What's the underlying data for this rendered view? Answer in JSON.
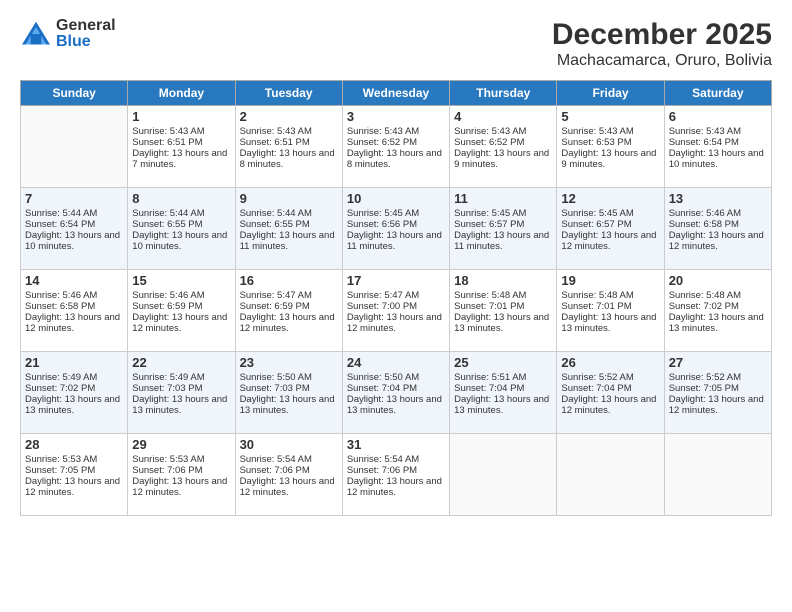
{
  "logo": {
    "general": "General",
    "blue": "Blue"
  },
  "title": "December 2025",
  "subtitle": "Machacamarca, Oruro, Bolivia",
  "days_of_week": [
    "Sunday",
    "Monday",
    "Tuesday",
    "Wednesday",
    "Thursday",
    "Friday",
    "Saturday"
  ],
  "weeks": [
    [
      {
        "day": "",
        "sunrise": "",
        "sunset": "",
        "daylight": ""
      },
      {
        "day": "1",
        "sunrise": "Sunrise: 5:43 AM",
        "sunset": "Sunset: 6:51 PM",
        "daylight": "Daylight: 13 hours and 7 minutes."
      },
      {
        "day": "2",
        "sunrise": "Sunrise: 5:43 AM",
        "sunset": "Sunset: 6:51 PM",
        "daylight": "Daylight: 13 hours and 8 minutes."
      },
      {
        "day": "3",
        "sunrise": "Sunrise: 5:43 AM",
        "sunset": "Sunset: 6:52 PM",
        "daylight": "Daylight: 13 hours and 8 minutes."
      },
      {
        "day": "4",
        "sunrise": "Sunrise: 5:43 AM",
        "sunset": "Sunset: 6:52 PM",
        "daylight": "Daylight: 13 hours and 9 minutes."
      },
      {
        "day": "5",
        "sunrise": "Sunrise: 5:43 AM",
        "sunset": "Sunset: 6:53 PM",
        "daylight": "Daylight: 13 hours and 9 minutes."
      },
      {
        "day": "6",
        "sunrise": "Sunrise: 5:43 AM",
        "sunset": "Sunset: 6:54 PM",
        "daylight": "Daylight: 13 hours and 10 minutes."
      }
    ],
    [
      {
        "day": "7",
        "sunrise": "Sunrise: 5:44 AM",
        "sunset": "Sunset: 6:54 PM",
        "daylight": "Daylight: 13 hours and 10 minutes."
      },
      {
        "day": "8",
        "sunrise": "Sunrise: 5:44 AM",
        "sunset": "Sunset: 6:55 PM",
        "daylight": "Daylight: 13 hours and 10 minutes."
      },
      {
        "day": "9",
        "sunrise": "Sunrise: 5:44 AM",
        "sunset": "Sunset: 6:55 PM",
        "daylight": "Daylight: 13 hours and 11 minutes."
      },
      {
        "day": "10",
        "sunrise": "Sunrise: 5:45 AM",
        "sunset": "Sunset: 6:56 PM",
        "daylight": "Daylight: 13 hours and 11 minutes."
      },
      {
        "day": "11",
        "sunrise": "Sunrise: 5:45 AM",
        "sunset": "Sunset: 6:57 PM",
        "daylight": "Daylight: 13 hours and 11 minutes."
      },
      {
        "day": "12",
        "sunrise": "Sunrise: 5:45 AM",
        "sunset": "Sunset: 6:57 PM",
        "daylight": "Daylight: 13 hours and 12 minutes."
      },
      {
        "day": "13",
        "sunrise": "Sunrise: 5:46 AM",
        "sunset": "Sunset: 6:58 PM",
        "daylight": "Daylight: 13 hours and 12 minutes."
      }
    ],
    [
      {
        "day": "14",
        "sunrise": "Sunrise: 5:46 AM",
        "sunset": "Sunset: 6:58 PM",
        "daylight": "Daylight: 13 hours and 12 minutes."
      },
      {
        "day": "15",
        "sunrise": "Sunrise: 5:46 AM",
        "sunset": "Sunset: 6:59 PM",
        "daylight": "Daylight: 13 hours and 12 minutes."
      },
      {
        "day": "16",
        "sunrise": "Sunrise: 5:47 AM",
        "sunset": "Sunset: 6:59 PM",
        "daylight": "Daylight: 13 hours and 12 minutes."
      },
      {
        "day": "17",
        "sunrise": "Sunrise: 5:47 AM",
        "sunset": "Sunset: 7:00 PM",
        "daylight": "Daylight: 13 hours and 12 minutes."
      },
      {
        "day": "18",
        "sunrise": "Sunrise: 5:48 AM",
        "sunset": "Sunset: 7:01 PM",
        "daylight": "Daylight: 13 hours and 13 minutes."
      },
      {
        "day": "19",
        "sunrise": "Sunrise: 5:48 AM",
        "sunset": "Sunset: 7:01 PM",
        "daylight": "Daylight: 13 hours and 13 minutes."
      },
      {
        "day": "20",
        "sunrise": "Sunrise: 5:48 AM",
        "sunset": "Sunset: 7:02 PM",
        "daylight": "Daylight: 13 hours and 13 minutes."
      }
    ],
    [
      {
        "day": "21",
        "sunrise": "Sunrise: 5:49 AM",
        "sunset": "Sunset: 7:02 PM",
        "daylight": "Daylight: 13 hours and 13 minutes."
      },
      {
        "day": "22",
        "sunrise": "Sunrise: 5:49 AM",
        "sunset": "Sunset: 7:03 PM",
        "daylight": "Daylight: 13 hours and 13 minutes."
      },
      {
        "day": "23",
        "sunrise": "Sunrise: 5:50 AM",
        "sunset": "Sunset: 7:03 PM",
        "daylight": "Daylight: 13 hours and 13 minutes."
      },
      {
        "day": "24",
        "sunrise": "Sunrise: 5:50 AM",
        "sunset": "Sunset: 7:04 PM",
        "daylight": "Daylight: 13 hours and 13 minutes."
      },
      {
        "day": "25",
        "sunrise": "Sunrise: 5:51 AM",
        "sunset": "Sunset: 7:04 PM",
        "daylight": "Daylight: 13 hours and 13 minutes."
      },
      {
        "day": "26",
        "sunrise": "Sunrise: 5:52 AM",
        "sunset": "Sunset: 7:04 PM",
        "daylight": "Daylight: 13 hours and 12 minutes."
      },
      {
        "day": "27",
        "sunrise": "Sunrise: 5:52 AM",
        "sunset": "Sunset: 7:05 PM",
        "daylight": "Daylight: 13 hours and 12 minutes."
      }
    ],
    [
      {
        "day": "28",
        "sunrise": "Sunrise: 5:53 AM",
        "sunset": "Sunset: 7:05 PM",
        "daylight": "Daylight: 13 hours and 12 minutes."
      },
      {
        "day": "29",
        "sunrise": "Sunrise: 5:53 AM",
        "sunset": "Sunset: 7:06 PM",
        "daylight": "Daylight: 13 hours and 12 minutes."
      },
      {
        "day": "30",
        "sunrise": "Sunrise: 5:54 AM",
        "sunset": "Sunset: 7:06 PM",
        "daylight": "Daylight: 13 hours and 12 minutes."
      },
      {
        "day": "31",
        "sunrise": "Sunrise: 5:54 AM",
        "sunset": "Sunset: 7:06 PM",
        "daylight": "Daylight: 13 hours and 12 minutes."
      },
      {
        "day": "",
        "sunrise": "",
        "sunset": "",
        "daylight": ""
      },
      {
        "day": "",
        "sunrise": "",
        "sunset": "",
        "daylight": ""
      },
      {
        "day": "",
        "sunrise": "",
        "sunset": "",
        "daylight": ""
      }
    ]
  ]
}
